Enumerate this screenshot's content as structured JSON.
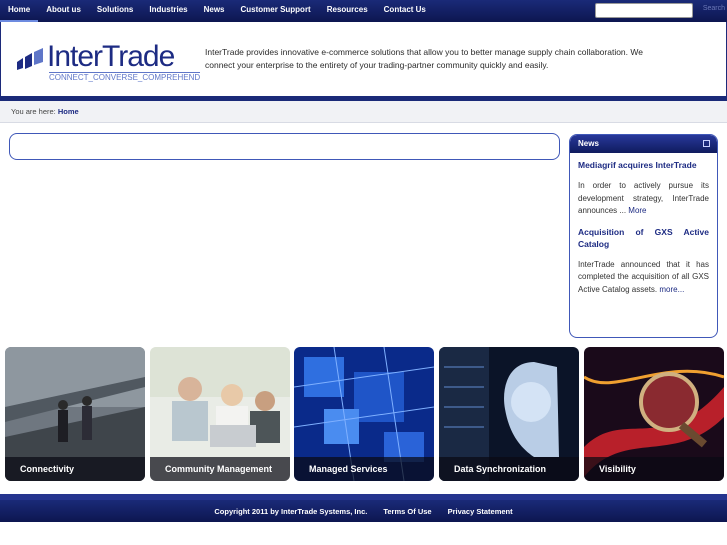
{
  "nav": {
    "items": [
      {
        "label": "Home"
      },
      {
        "label": "About us"
      },
      {
        "label": "Solutions"
      },
      {
        "label": "Industries"
      },
      {
        "label": "News"
      },
      {
        "label": "Customer Support"
      },
      {
        "label": "Resources"
      },
      {
        "label": "Contact Us"
      }
    ],
    "search_value": "",
    "search_label": "Search"
  },
  "header": {
    "logo_text": "InterTrade",
    "logo_tagline": "CONNECT_CONVERSE_COMPREHEND",
    "blurb": "InterTrade provides innovative e-commerce solutions that allow you to better manage supply chain collaboration. We connect your enterprise to the entirety of your trading-partner community quickly and easily."
  },
  "breadcrumb": {
    "prefix": "You are here:",
    "current": "Home"
  },
  "news": {
    "heading": "News",
    "items": [
      {
        "title": "Mediagrif acquires InterTrade",
        "text": "In order to actively pursue its development strategy, InterTrade announces ...",
        "more": "More"
      },
      {
        "title": "Acquisition of GXS Active Catalog",
        "text": "InterTrade announced that it has completed the acquisition of all GXS Active Catalog assets.",
        "more": "more..."
      }
    ]
  },
  "tiles": [
    {
      "label": "Connectivity"
    },
    {
      "label": "Community Management"
    },
    {
      "label": "Managed Services"
    },
    {
      "label": "Data Synchronization"
    },
    {
      "label": "Visibility"
    }
  ],
  "footer": {
    "copyright": "Copyright 2011 by InterTrade Systems, Inc.",
    "terms": "Terms Of Use",
    "privacy": "Privacy Statement"
  },
  "colors": {
    "brand_navy": "#1a2a78",
    "link_blue": "#1d2b83"
  }
}
